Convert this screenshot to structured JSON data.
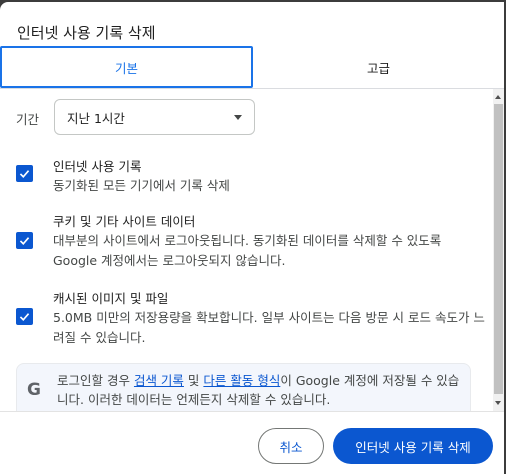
{
  "dialog": {
    "title": "인터넷 사용 기록 삭제",
    "tabs": [
      {
        "label": "기본",
        "selected": true
      },
      {
        "label": "고급",
        "selected": false
      }
    ],
    "period": {
      "label": "기간",
      "selected_value": "지난 1시간"
    },
    "options": [
      {
        "title": "인터넷 사용 기록",
        "desc": "동기화된 모든 기기에서 기록 삭제",
        "checked": true
      },
      {
        "title": "쿠키 및 기타 사이트 데이터",
        "desc": "대부분의 사이트에서 로그아웃됩니다. 동기화된 데이터를 삭제할 수 있도록 Google 계정에서는 로그아웃되지 않습니다.",
        "checked": true
      },
      {
        "title": "캐시된 이미지 및 파일",
        "desc": "5.0MB 미만의 저장용량을 확보합니다. 일부 사이트는 다음 방문 시 로드 속도가 느려질 수 있습니다.",
        "checked": true
      }
    ],
    "notice": {
      "icon": "G",
      "text_before": "로그인할 경우 ",
      "link1": "검색 기록",
      "text_mid": " 및 ",
      "link2": "다른 활동 형식",
      "text_after": "이 Google 계정에 저장될 수 있습니다. 이러한 데이터는 언제든지 삭제할 수 있습니다."
    },
    "buttons": {
      "cancel": "취소",
      "delete": "인터넷 사용 기록 삭제"
    },
    "colors": {
      "accent": "#0b57d0",
      "tab_accent": "#1a73e8"
    }
  }
}
